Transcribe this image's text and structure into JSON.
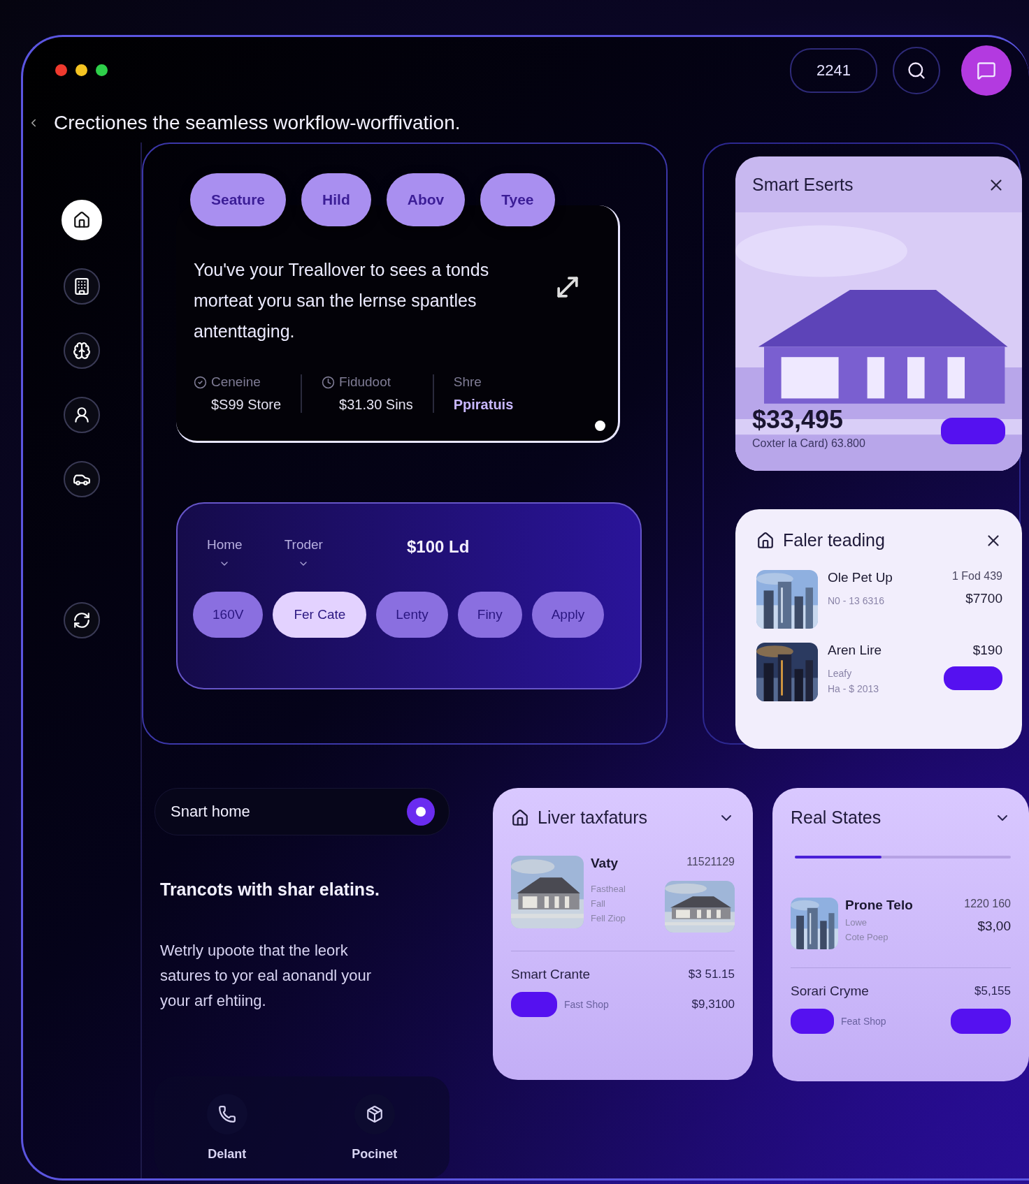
{
  "header": {
    "counter": "2241"
  },
  "title": {
    "text": "Crectiones the seamless workflow-worffivation."
  },
  "sidebar": {
    "items": [
      {
        "selected": true
      },
      {
        "selected": false
      },
      {
        "selected": false
      },
      {
        "selected": false
      },
      {
        "selected": false
      },
      {
        "selected": false
      }
    ]
  },
  "main_panel": {
    "chips": [
      {
        "label": "Seature"
      },
      {
        "label": "Hild"
      },
      {
        "label": "Abov"
      },
      {
        "label": "Tyee"
      }
    ],
    "card": {
      "text": "You've your Treallover to sees a tonds morteat yoru san the lernse spantles antenttaging.",
      "stats": [
        {
          "kind": "icon",
          "label": "Ceneine",
          "value": "$S99 Store"
        },
        {
          "kind": "icon",
          "label": "Fidudoot",
          "value": "$31.30 Sins"
        },
        {
          "kind": "accent",
          "label": "Shre",
          "value": "Ppiratuis"
        }
      ]
    }
  },
  "filter": {
    "dropdowns": [
      {
        "label": "Home"
      },
      {
        "label": "Troder"
      }
    ],
    "price": "$100 Ld",
    "chips": [
      {
        "label": "160V",
        "selected": false
      },
      {
        "label": "Fer Cate",
        "selected": true
      },
      {
        "label": "Lenty",
        "selected": false
      },
      {
        "label": "Finy",
        "selected": false
      },
      {
        "label": "Apply",
        "selected": false
      }
    ]
  },
  "featured": {
    "title": "Smart Eserts",
    "price": "$33,495",
    "subtitle": "Coxter la Card) 63.800"
  },
  "listing_card": {
    "title": "Faler teading",
    "items": [
      {
        "name": "Ole Pet Up",
        "details": [
          "N0 - 13 6316"
        ],
        "prices": [
          "1 Fod 439",
          "$7700"
        ],
        "button": false
      },
      {
        "name": "Aren Lire",
        "details": [
          "Leafy",
          "Ha - $ 2013"
        ],
        "prices": [
          "$190"
        ],
        "button": true
      }
    ]
  },
  "smart_home": {
    "label": "Snart home",
    "on": true,
    "heading": "Trancots with shar elatins.",
    "body": "Wetrly upoote that the leork satures to yor eal aonandl your your arf ehtiing.",
    "nav": [
      {
        "label": "Delant"
      },
      {
        "label": "Pocinet"
      }
    ]
  },
  "liver": {
    "title": "Liver taxfaturs",
    "listing": {
      "name": "Vaty",
      "code": "11521129",
      "details": [
        "Fastheal",
        "Fall",
        "Fell Ziop"
      ]
    },
    "summary": {
      "name": "Smart Crante",
      "value": "$3 51.15",
      "tag": "Fast Shop",
      "total": "$9,3100"
    }
  },
  "real_states": {
    "title": "Real States",
    "level": 0.4,
    "listing": {
      "name": "Prone Telo",
      "code": "1220 160",
      "details": [
        "Lowe",
        "Cote Poep"
      ],
      "price": "$3,00"
    },
    "summary": {
      "name": "Sorari Cryme",
      "value": "$5,155",
      "tag": "Feat Shop"
    }
  }
}
